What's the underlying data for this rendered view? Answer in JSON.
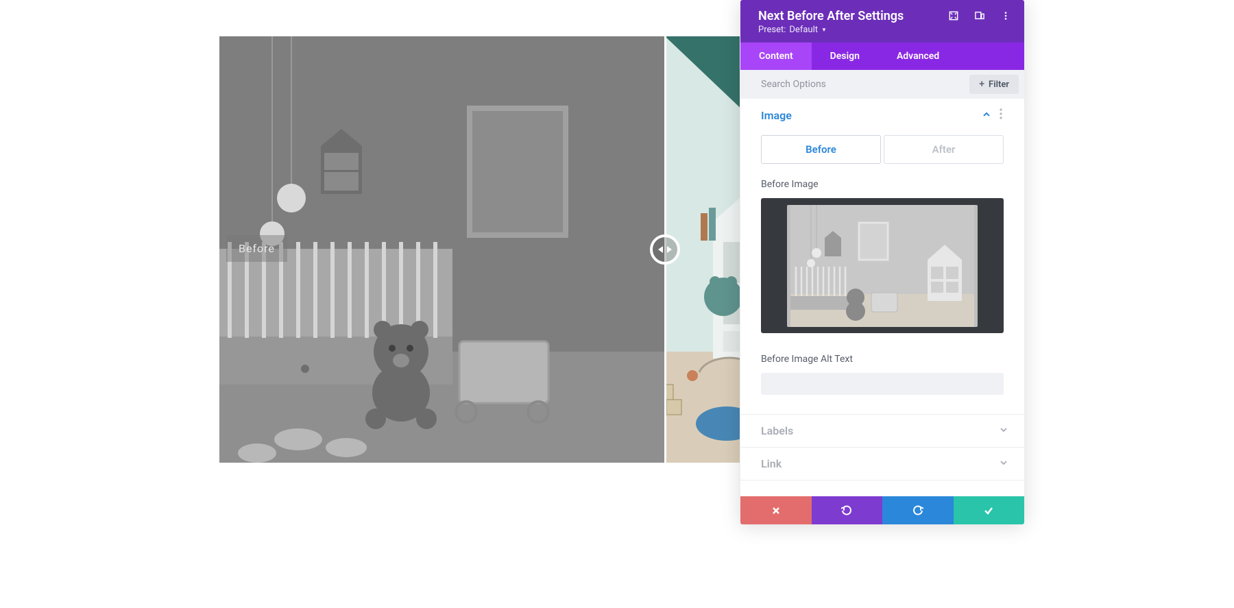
{
  "header": {
    "title": "Next Before After Settings",
    "preset_label": "Preset:",
    "preset_value": "Default"
  },
  "tabs": {
    "content": "Content",
    "design": "Design",
    "advanced": "Advanced"
  },
  "search": {
    "placeholder": "Search Options",
    "filter_label": "Filter"
  },
  "sections": {
    "image": {
      "title": "Image",
      "before_tab": "Before",
      "after_tab": "After",
      "before_image_label": "Before Image",
      "alt_text_label": "Before Image Alt Text",
      "alt_text_value": ""
    },
    "labels": {
      "title": "Labels"
    },
    "link": {
      "title": "Link"
    }
  },
  "preview": {
    "before_label": "Before"
  },
  "icons": {
    "expand": "expand-icon",
    "responsive": "devices-icon",
    "more": "more-icon",
    "section_more": "more-icon",
    "chevron_up": "chevron-up-icon",
    "chevron_down": "chevron-down-icon"
  }
}
